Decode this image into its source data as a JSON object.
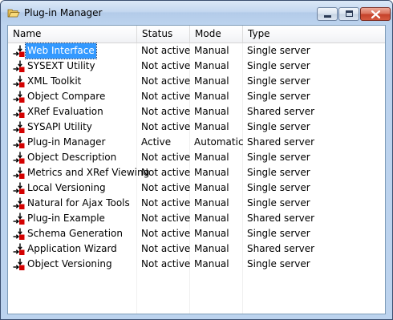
{
  "window": {
    "title": "Plug-in Manager",
    "icon": "folder-open-icon",
    "controls": [
      "minimize",
      "maximize",
      "close"
    ]
  },
  "columns": {
    "name": "Name",
    "status": "Status",
    "mode": "Mode",
    "type": "Type"
  },
  "colors": {
    "selection": "#3399ff",
    "icon_red": "#d40000"
  },
  "plugins": [
    {
      "name": "Web Interface",
      "status": "Not active",
      "mode": "Manual",
      "type": "Single server",
      "selected": true
    },
    {
      "name": "SYSEXT Utility",
      "status": "Not active",
      "mode": "Manual",
      "type": "Single server"
    },
    {
      "name": "XML Toolkit",
      "status": "Not active",
      "mode": "Manual",
      "type": "Single server"
    },
    {
      "name": "Object Compare",
      "status": "Not active",
      "mode": "Manual",
      "type": "Single server"
    },
    {
      "name": "XRef Evaluation",
      "status": "Not active",
      "mode": "Manual",
      "type": "Shared server"
    },
    {
      "name": "SYSAPI Utility",
      "status": "Not active",
      "mode": "Manual",
      "type": "Single server"
    },
    {
      "name": "Plug-in Manager",
      "status": "Active",
      "mode": "Automatic",
      "type": "Shared server"
    },
    {
      "name": "Object Description",
      "status": "Not active",
      "mode": "Manual",
      "type": "Single server"
    },
    {
      "name": "Metrics and XRef Viewing",
      "status": "Not active",
      "mode": "Manual",
      "type": "Single server"
    },
    {
      "name": "Local Versioning",
      "status": "Not active",
      "mode": "Manual",
      "type": "Single server"
    },
    {
      "name": "Natural for Ajax Tools",
      "status": "Not active",
      "mode": "Manual",
      "type": "Single server"
    },
    {
      "name": "Plug-in Example",
      "status": "Not active",
      "mode": "Manual",
      "type": "Shared server"
    },
    {
      "name": "Schema Generation",
      "status": "Not active",
      "mode": "Manual",
      "type": "Single server"
    },
    {
      "name": "Application Wizard",
      "status": "Not active",
      "mode": "Manual",
      "type": "Shared server"
    },
    {
      "name": "Object Versioning",
      "status": "Not active",
      "mode": "Manual",
      "type": "Single server"
    }
  ]
}
